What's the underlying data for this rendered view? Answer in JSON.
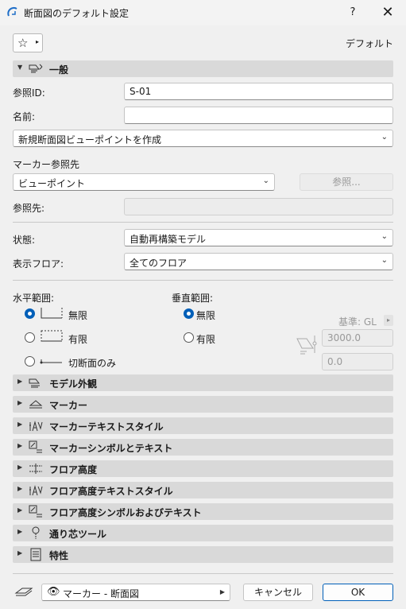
{
  "window": {
    "title": "断面図のデフォルト設定",
    "help": "?",
    "close": "✕"
  },
  "favorites": {
    "star": "☆",
    "arrow": "▸",
    "default_label": "デフォルト"
  },
  "general": {
    "header": "一般",
    "ref_id_label": "参照ID:",
    "ref_id_value": "S-01",
    "name_label": "名前:",
    "name_value": "",
    "viewpoint_select": "新規断面図ビューポイントを作成",
    "marker_ref_label": "マーカー参照先",
    "marker_ref_select": "ビューポイント",
    "browse_button": "参照...",
    "ref_to_label": "参照先:",
    "ref_to_value": "",
    "status_label": "状態:",
    "status_select": "自動再構築モデル",
    "display_floor_label": "表示フロア:",
    "display_floor_select": "全てのフロア",
    "horizontal_range_label": "水平範囲:",
    "vertical_range_label": "垂直範囲:",
    "h_infinite": "無限",
    "h_limited": "有限",
    "h_cut_only": "切断面のみ",
    "v_infinite": "無限",
    "v_limited": "有限",
    "base_label": "基準: GL",
    "top_value": "3000.0",
    "bottom_value": "0.0"
  },
  "panels": [
    {
      "label": "モデル外観",
      "icon": "model-appearance-icon"
    },
    {
      "label": "マーカー",
      "icon": "marker-icon"
    },
    {
      "label": "マーカーテキストスタイル",
      "icon": "text-style-icon"
    },
    {
      "label": "マーカーシンボルとテキスト",
      "icon": "symbol-text-icon"
    },
    {
      "label": "フロア高度",
      "icon": "floor-level-icon"
    },
    {
      "label": "フロア高度テキストスタイル",
      "icon": "text-style-icon"
    },
    {
      "label": "フロア高度シンボルおよびテキスト",
      "icon": "symbol-text-icon"
    },
    {
      "label": "通り芯ツール",
      "icon": "grid-tool-icon"
    },
    {
      "label": "特性",
      "icon": "properties-icon"
    }
  ],
  "footer": {
    "layer_select": "マーカー - 断面図",
    "cancel": "キャンセル",
    "ok": "OK"
  }
}
